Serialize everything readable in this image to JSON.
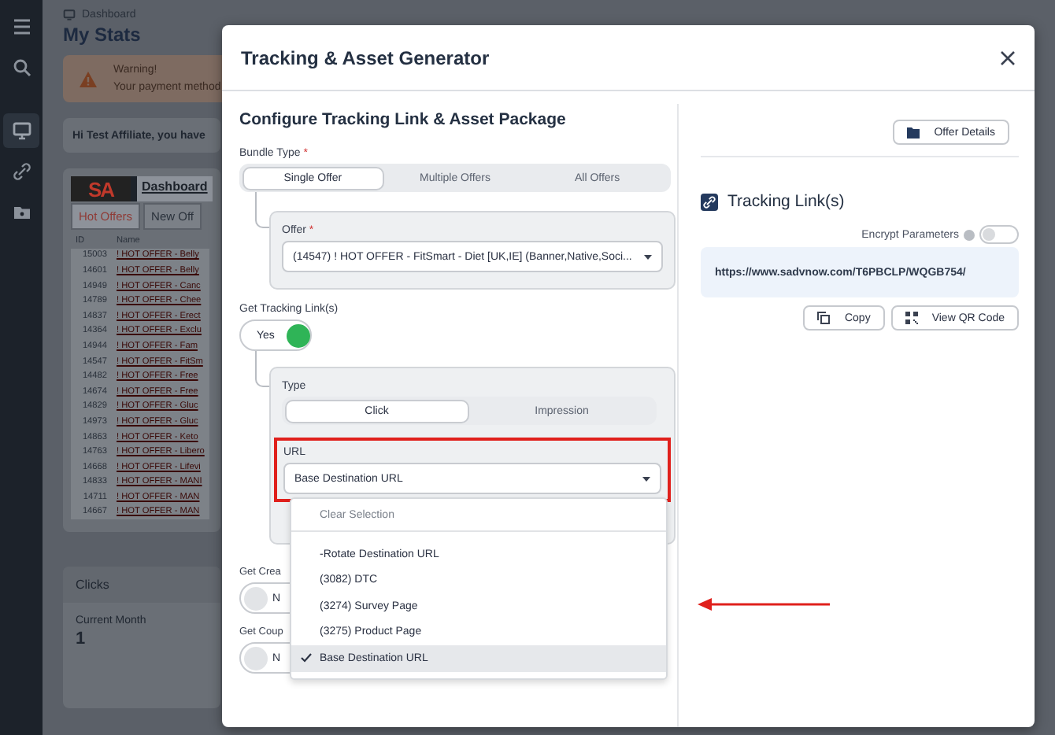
{
  "sidebar": {
    "items": [
      {
        "kind": "menu",
        "selected": false
      },
      {
        "kind": "search",
        "selected": false
      },
      {
        "kind": "monitor",
        "selected": true
      },
      {
        "kind": "link",
        "selected": false
      },
      {
        "kind": "folder",
        "selected": false
      }
    ]
  },
  "page": {
    "breadcrumb": "Dashboard",
    "title": "My Stats",
    "warning": {
      "title": "Warning!",
      "text": "Your payment method"
    },
    "greeting": "Hi Test Affiliate, you have",
    "widget": {
      "logo": "SA",
      "title": "Dashboard",
      "tabs": [
        {
          "label": "Hot Offers",
          "selected": true
        },
        {
          "label": "New Off",
          "selected": false
        }
      ],
      "columns": [
        "ID",
        "Name"
      ],
      "rows": [
        {
          "id": "15003",
          "name": "! HOT OFFER - Belly"
        },
        {
          "id": "14601",
          "name": "! HOT OFFER - Belly"
        },
        {
          "id": "14949",
          "name": "! HOT OFFER - Canc"
        },
        {
          "id": "14789",
          "name": "! HOT OFFER - Chee"
        },
        {
          "id": "14837",
          "name": "! HOT OFFER - Erect"
        },
        {
          "id": "14364",
          "name": "! HOT OFFER - Exclu"
        },
        {
          "id": "14944",
          "name": "! HOT OFFER - Fam"
        },
        {
          "id": "14547",
          "name": "! HOT OFFER - FitSm"
        },
        {
          "id": "14482",
          "name": "! HOT OFFER - Free"
        },
        {
          "id": "14674",
          "name": "! HOT OFFER - Free"
        },
        {
          "id": "14829",
          "name": "! HOT OFFER - Gluc"
        },
        {
          "id": "14973",
          "name": "! HOT OFFER - Gluc"
        },
        {
          "id": "14863",
          "name": "! HOT OFFER - Keto"
        },
        {
          "id": "14763",
          "name": "! HOT OFFER - Libero"
        },
        {
          "id": "14668",
          "name": "! HOT OFFER - Lifevi"
        },
        {
          "id": "14833",
          "name": "! HOT OFFER - MANI"
        },
        {
          "id": "14711",
          "name": "! HOT OFFER - MAN"
        },
        {
          "id": "14667",
          "name": "! HOT OFFER - MAN"
        }
      ]
    },
    "clicks": {
      "title": "Clicks",
      "period": "Current Month",
      "value": "1"
    }
  },
  "modal": {
    "title": "Tracking & Asset Generator",
    "heading": "Configure Tracking Link & Asset Package",
    "bundle_type": {
      "label": "Bundle Type",
      "required_mark": "*",
      "options": [
        {
          "label": "Single Offer",
          "selected": true
        },
        {
          "label": "Multiple Offers",
          "selected": false
        },
        {
          "label": "All Offers",
          "selected": false
        }
      ]
    },
    "offer": {
      "label": "Offer",
      "required_mark": "*",
      "value": "(14547) ! HOT OFFER - FitSmart - Diet [UK,IE] (Banner,Native,Soci..."
    },
    "get_tracking": {
      "label": "Get Tracking Link(s)",
      "toggle": {
        "label": "Yes",
        "on": true
      }
    },
    "type": {
      "label": "Type",
      "options": [
        {
          "label": "Click",
          "selected": true
        },
        {
          "label": "Impression",
          "selected": false
        }
      ]
    },
    "url": {
      "label": "URL",
      "value": "Base Destination URL",
      "highlighted": true,
      "menu": {
        "clear": "Clear Selection",
        "options": [
          {
            "label": "-Rotate Destination URL",
            "selected": false
          },
          {
            "label": "(3082) DTC",
            "selected": false
          },
          {
            "label": "(3274) Survey Page",
            "selected": false
          },
          {
            "label": "(3275) Product Page",
            "selected": false
          },
          {
            "label": "Base Destination URL",
            "selected": true
          }
        ]
      }
    },
    "get_creatives": {
      "label": "Get Crea",
      "toggle": {
        "label": "N",
        "on": false
      }
    },
    "get_coupons": {
      "label": "Get Coup",
      "toggle": {
        "label": "N",
        "on": false
      }
    },
    "offer_details": "Offer Details",
    "tracking_title": "Tracking Link(s)",
    "encrypt": {
      "label": "Encrypt Parameters",
      "on": false
    },
    "link": "https://www.sadvnow.com/T6PBCLP/WQGB754/",
    "actions": [
      {
        "label": "Copy",
        "kind": "copy"
      },
      {
        "label": "View QR Code",
        "kind": "qr"
      }
    ]
  },
  "annotation": {
    "arrow": true
  }
}
